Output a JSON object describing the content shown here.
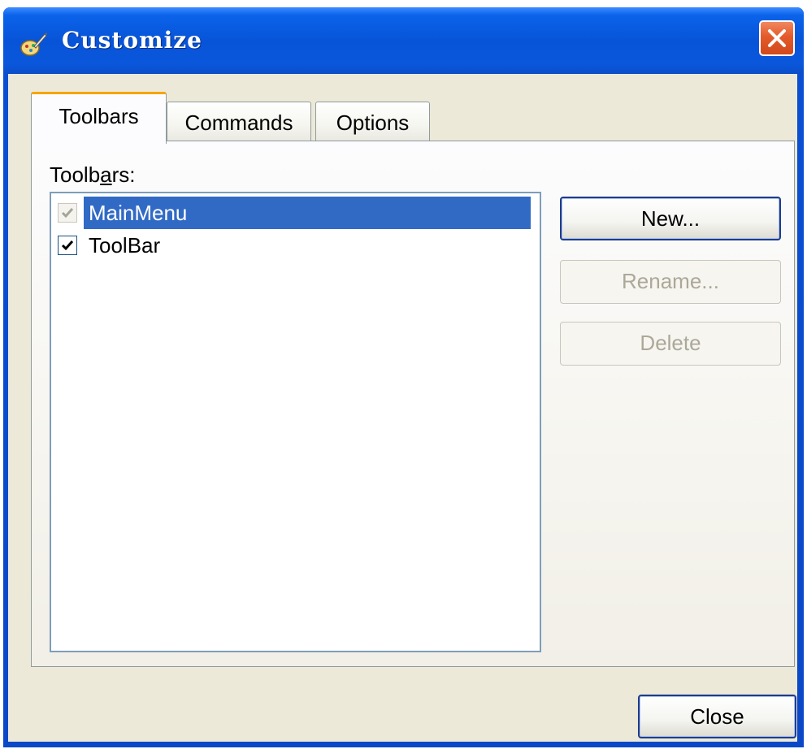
{
  "window": {
    "title": "Customize",
    "close_icon": "close-x-icon"
  },
  "tabs": [
    {
      "label": "Toolbars",
      "selected": true
    },
    {
      "label": "Commands",
      "selected": false
    },
    {
      "label": "Options",
      "selected": false
    }
  ],
  "toolbars_panel": {
    "list_label_pre": "Toolb",
    "list_label_mnemonic": "a",
    "list_label_post": "rs:",
    "items": [
      {
        "label": "MainMenu",
        "checked": true,
        "enabled": false,
        "selected": true
      },
      {
        "label": "ToolBar",
        "checked": true,
        "enabled": true,
        "selected": false
      }
    ],
    "buttons": {
      "new_label": "New...",
      "rename_label": "Rename...",
      "delete_label": "Delete"
    }
  },
  "footer": {
    "close_label": "Close"
  },
  "colors": {
    "titlebar": "#0a55dc",
    "selection": "#316ac5",
    "client_bg": "#ece9d8",
    "tab_highlight": "#f7a400",
    "disabled_text": "#aca899"
  }
}
